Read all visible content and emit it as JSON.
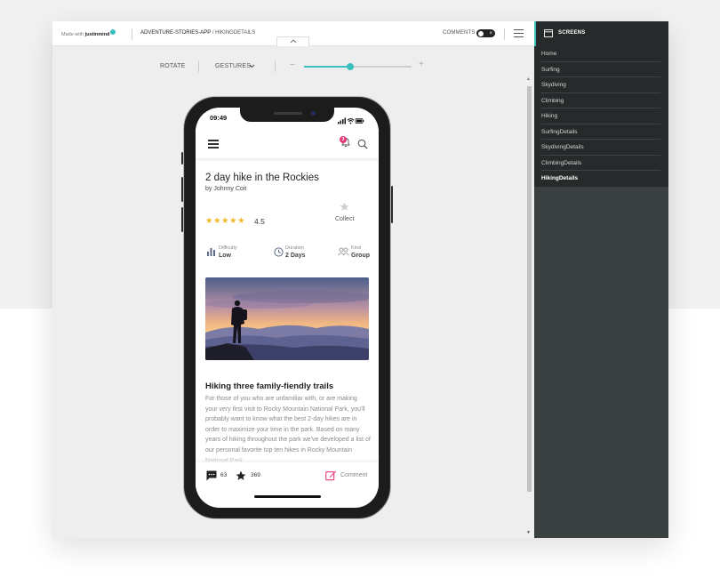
{
  "header": {
    "made_with": "Made with",
    "brand": "justinmind",
    "project": "ADVENTURE-STORIES-APP",
    "separator": "/",
    "page": "HIKINGDETAILS",
    "comments_label": "COMMENTS",
    "comments_toggle_icon": "×"
  },
  "toolbar": {
    "rotate": "ROTATE",
    "gestures": "GESTURES",
    "zoom_minus": "−",
    "zoom_plus": "+",
    "zoom_level": 0.43
  },
  "phone": {
    "status_time": "09:49",
    "notification_count": "3",
    "title": "2 day hike in the Rockies",
    "author": "by Johnny Coit",
    "stars": "★★★★★",
    "rating": "4.5",
    "collect": "Collect",
    "stats": [
      {
        "label": "Difficulty",
        "value": "Low"
      },
      {
        "label": "Duration",
        "value": "2 Days"
      },
      {
        "label": "Kind",
        "value": "Group"
      }
    ],
    "section_title": "Hiking three family-fiendly trails",
    "body": "For those of you who are unfamiliar with, or are making your very first visit to Rocky Mountain National Park, you'll probably want to know what the best 2-day hikes are in order to maximize your time in the park. Based on many years of hiking throughout the park we've developed a list of our personal favorite top ten hikes in Rocky Mountain National Park.",
    "comments_count": "63",
    "favorites_count": "369",
    "comment_action": "Comment"
  },
  "screens_panel": {
    "title": "SCREENS",
    "items": [
      "Home",
      "Surfing",
      "Skydiving",
      "Climbing",
      "Hiking",
      "SurfingDetails",
      "SkydivingDetails",
      "ClimbingDetails",
      "HikingDetails"
    ],
    "active": "HikingDetails"
  },
  "colors": {
    "accent": "#3bbfbf",
    "star": "#f2b928",
    "badge": "#e8367a",
    "panel_dark": "#262a2b"
  }
}
